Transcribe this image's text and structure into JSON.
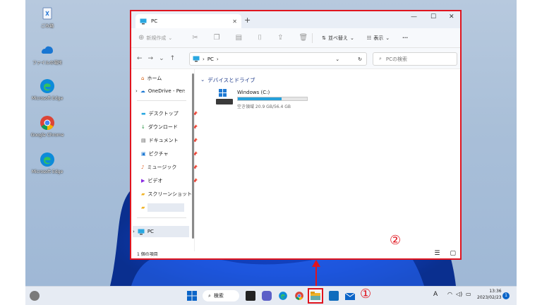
{
  "desktop": {
    "icons": [
      {
        "label": "ごみ箱",
        "icon": "recycle-bin-icon"
      },
      {
        "label": "ファイルの場所",
        "icon": "onedrive-shortcut-icon"
      },
      {
        "label": "Microsoft Edge",
        "icon": "edge-icon"
      },
      {
        "label": "Google Chrome",
        "icon": "chrome-icon"
      },
      {
        "label": "Microsoft Edge",
        "icon": "edge-icon"
      }
    ]
  },
  "window": {
    "tab_title": "PC",
    "commands": {
      "new": "新規作成",
      "sort": "並べ替え",
      "view": "表示",
      "more": "···"
    },
    "address": {
      "path": "PC"
    },
    "search": {
      "placeholder": "PCの検索"
    },
    "nav": [
      {
        "label": "ホーム",
        "icon": "home-icon"
      },
      {
        "label": "OneDrive - Perso",
        "icon": "onedrive-icon"
      },
      {
        "label": "デスクトップ",
        "icon": "desktop-icon"
      },
      {
        "label": "ダウンロード",
        "icon": "download-icon"
      },
      {
        "label": "ドキュメント",
        "icon": "document-icon"
      },
      {
        "label": "ピクチャ",
        "icon": "picture-icon"
      },
      {
        "label": "ミュージック",
        "icon": "music-icon"
      },
      {
        "label": "ビデオ",
        "icon": "video-icon"
      },
      {
        "label": "スクリーンショット",
        "icon": "folder-icon"
      },
      {
        "label": "",
        "icon": "folder-icon"
      },
      {
        "label": "PC",
        "icon": "pc-icon"
      }
    ],
    "section": "デバイスとドライブ",
    "drive": {
      "name": "Windows (C:)",
      "free": "空き領域 20.9 GB/56.4 GB",
      "used_fraction": 0.63
    },
    "status": "1 個の項目"
  },
  "taskbar": {
    "search": "検索",
    "time": "13:36",
    "date": "2023/02/23",
    "notif": "1",
    "ime": "A"
  },
  "annotations": {
    "one": "①",
    "two": "②"
  },
  "colors": {
    "highlight": "#e0141e",
    "accent": "#0a64c8"
  }
}
